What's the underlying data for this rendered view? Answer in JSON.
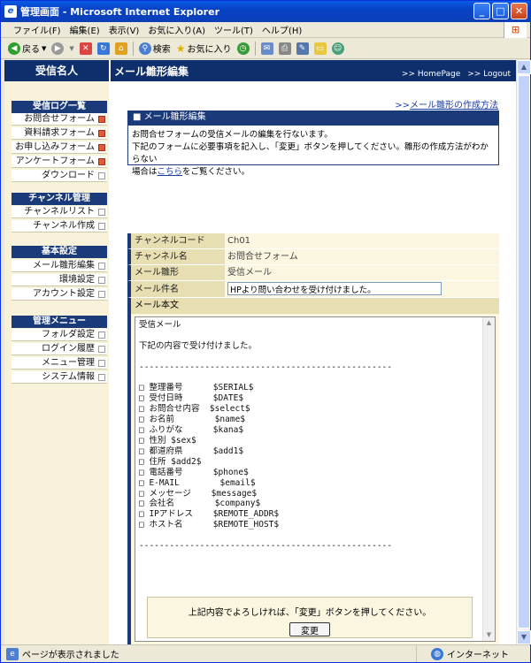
{
  "window": {
    "title": "管理画面 - Microsoft Internet Explorer"
  },
  "menubar": [
    "ファイル(F)",
    "編集(E)",
    "表示(V)",
    "お気に入り(A)",
    "ツール(T)",
    "ヘルプ(H)"
  ],
  "toolbar": {
    "back": "戻る",
    "search": "検索",
    "favorites": "お気に入り"
  },
  "header": {
    "brand": "受信名人",
    "page_title": "メール雛形編集",
    "home_link": ">> HomePage",
    "logout_link": ">> Logout"
  },
  "sidebar": {
    "sections": [
      {
        "title": "受信ログ一覧",
        "items": [
          "お問合せフォーム",
          "資料請求フォーム",
          "お申し込みフォーム",
          "アンケートフォーム",
          "ダウンロード"
        ]
      },
      {
        "title": "チャンネル管理",
        "items": [
          "チャンネルリスト",
          "チャンネル作成"
        ]
      },
      {
        "title": "基本設定",
        "items": [
          "メール雛形編集",
          "環境設定",
          "アカウント設定"
        ]
      },
      {
        "title": "管理メニュー",
        "items": [
          "フォルダ設定",
          "ログイン履歴",
          "メニュー管理",
          "システム情報"
        ]
      }
    ]
  },
  "content": {
    "howto_prefix": ">>",
    "howto_link": "メール雛形の作成方法",
    "section_title": "■ メール雛形編集",
    "desc_line1": "お問合せフォームの受信メールの編集を行ないます。",
    "desc_line2": "下記のフォームに必要事項を記入し、「変更」ボタンを押してください。雛形の作成方法がわからない",
    "desc_line3_pre": "場合は",
    "desc_line3_link": "こちら",
    "desc_line3_post": "をご覧ください。",
    "fields": [
      {
        "label": "チャンネルコード",
        "value": "Ch01"
      },
      {
        "label": "チャンネル名",
        "value": "お問合せフォーム"
      },
      {
        "label": "メール雛形",
        "value": "受信メール"
      }
    ],
    "subject_label": "メール件名",
    "subject_value": "HPより問い合わせを受け付けました。",
    "body_label": "メール本文",
    "body_text": "受信メール\n\n下記の内容で受け付けました。\n\n--------------------------------------------------\n\n□ 整理番号      $SERIAL$\n□ 受付日時      $DATE$\n□ お問合せ内容  $select$\n□ お名前        $name$\n□ ふりがな      $kana$\n□ 性別 $sex$\n□ 都道府県      $add1$\n□ 住所 $add2$\n□ 電話番号      $phone$\n□ E-MAIL        $email$\n□ メッセージ    $message$\n□ 会社名        $company$\n□ IPアドレス    $REMOTE_ADDR$\n□ ホスト名      $REMOTE_HOST$\n\n--------------------------------------------------",
    "confirm_text": "上記内容でよろしければ、「変更」ボタンを押してください。",
    "submit_label": "変更"
  },
  "status": {
    "left": "ページが表示されました",
    "right": "インターネット"
  }
}
